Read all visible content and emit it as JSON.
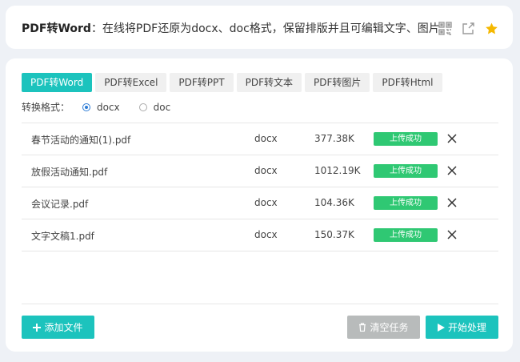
{
  "header": {
    "title_bold": "PDF转Word",
    "title_rest": "：在线将PDF还原为docx、doc格式，保留排版并且可编辑文字、图片",
    "icons": [
      "qrcode-icon",
      "share-icon",
      "star-icon"
    ],
    "star_color": "#f5b800"
  },
  "tabs": [
    {
      "label": "PDF转Word",
      "active": true
    },
    {
      "label": "PDF转Excel",
      "active": false
    },
    {
      "label": "PDF转PPT",
      "active": false
    },
    {
      "label": "PDF转文本",
      "active": false
    },
    {
      "label": "PDF转图片",
      "active": false
    },
    {
      "label": "PDF转Html",
      "active": false
    }
  ],
  "format": {
    "label": "转换格式：",
    "options": [
      {
        "label": "docx",
        "checked": true
      },
      {
        "label": "doc",
        "checked": false
      }
    ]
  },
  "files": [
    {
      "name": "春节活动的通知(1).pdf",
      "format": "docx",
      "size": "377.38K",
      "status": "上传成功"
    },
    {
      "name": "放假活动通知.pdf",
      "format": "docx",
      "size": "1012.19K",
      "status": "上传成功"
    },
    {
      "name": "会议记录.pdf",
      "format": "docx",
      "size": "104.36K",
      "status": "上传成功"
    },
    {
      "name": "文字文稿1.pdf",
      "format": "docx",
      "size": "150.37K",
      "status": "上传成功"
    }
  ],
  "actions": {
    "add_label": "添加文件",
    "clear_label": "清空任务",
    "start_label": "开始处理"
  },
  "colors": {
    "accent": "#1cc3bd",
    "success": "#2fc873",
    "disabled": "#b8bbbb",
    "radio": "#2b7bd6"
  }
}
